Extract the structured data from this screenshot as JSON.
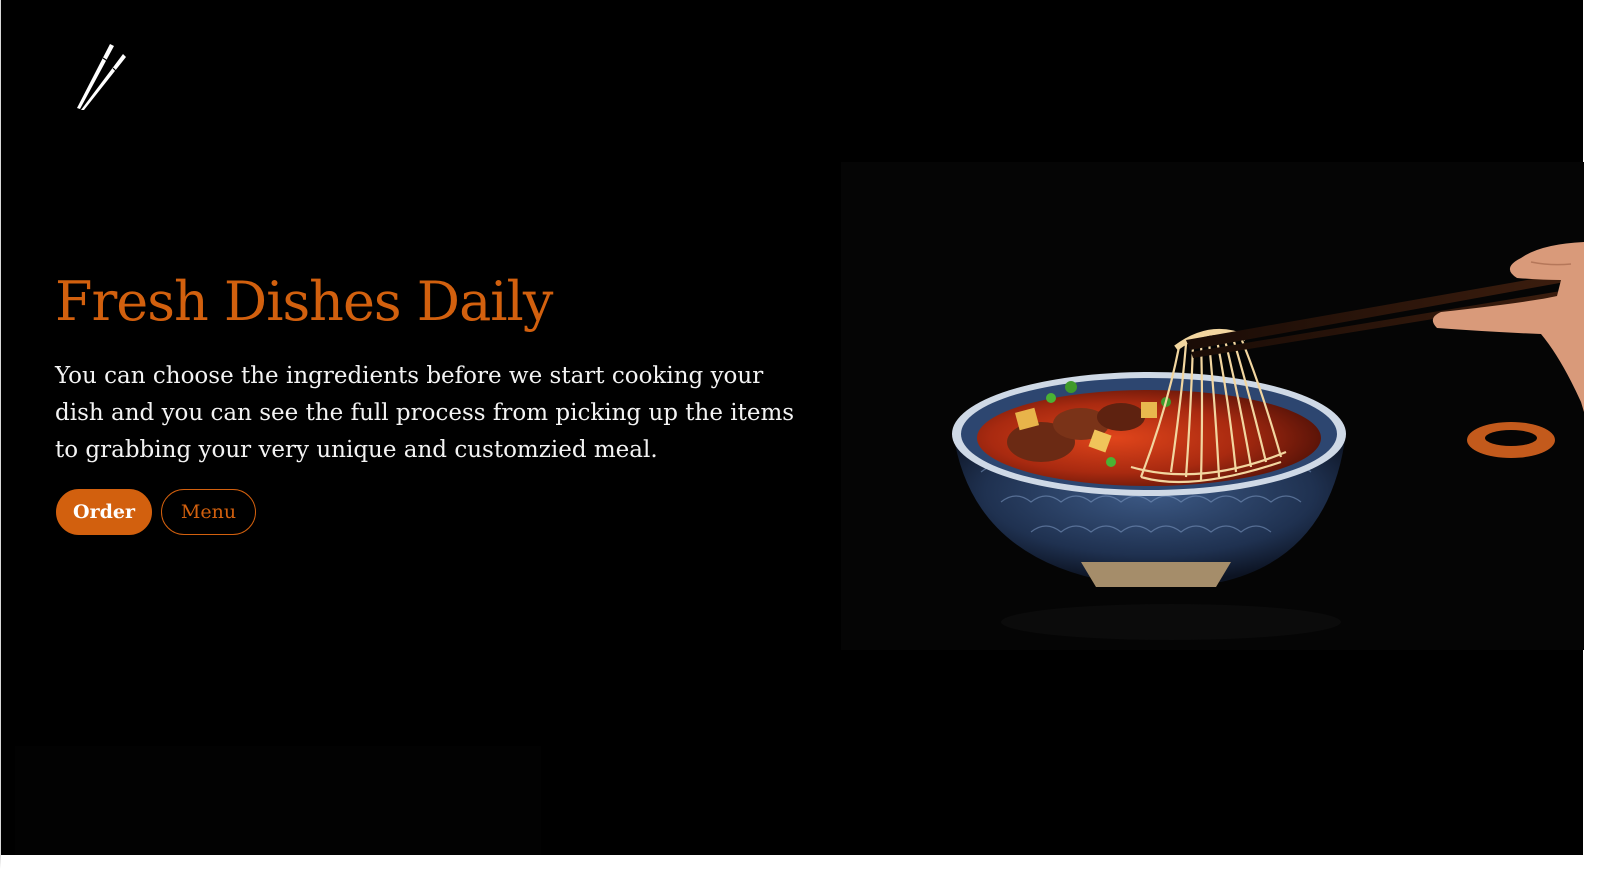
{
  "logo": {
    "icon": "chopsticks-icon"
  },
  "hero": {
    "title": "Fresh Dishes Daily",
    "description": "You can choose the ingredients before we start cooking your dish and you can see the full process from picking up the items to grabbing your very unique and customzied meal.",
    "order_label": "Order",
    "menu_label": "Menu"
  },
  "colors": {
    "accent": "#d2600e",
    "background": "#000000",
    "text": "#ffffff"
  }
}
